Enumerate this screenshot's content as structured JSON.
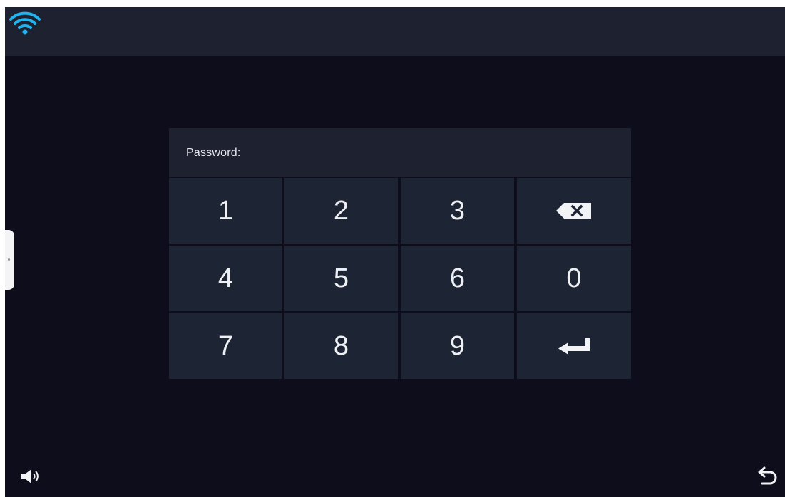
{
  "status_bar": {
    "wifi_icon": "wifi-icon",
    "accent_color": "#1fb6f0"
  },
  "keypad": {
    "password_label": "Password:",
    "rows": [
      [
        "1",
        "2",
        "3",
        "backspace"
      ],
      [
        "4",
        "5",
        "6",
        "0"
      ],
      [
        "7",
        "8",
        "9",
        "enter"
      ]
    ],
    "key_1": "1",
    "key_2": "2",
    "key_3": "3",
    "key_4": "4",
    "key_5": "5",
    "key_6": "6",
    "key_0": "0",
    "key_7": "7",
    "key_8": "8",
    "key_9": "9",
    "backspace_icon": "backspace-icon",
    "enter_icon": "enter-icon"
  },
  "bottom_bar": {
    "volume_icon": "volume-icon",
    "back_icon": "back-icon"
  },
  "colors": {
    "background": "#0e0d1b",
    "bar": "#1d2130",
    "key": "#1d2433",
    "text": "#eef0f4"
  }
}
